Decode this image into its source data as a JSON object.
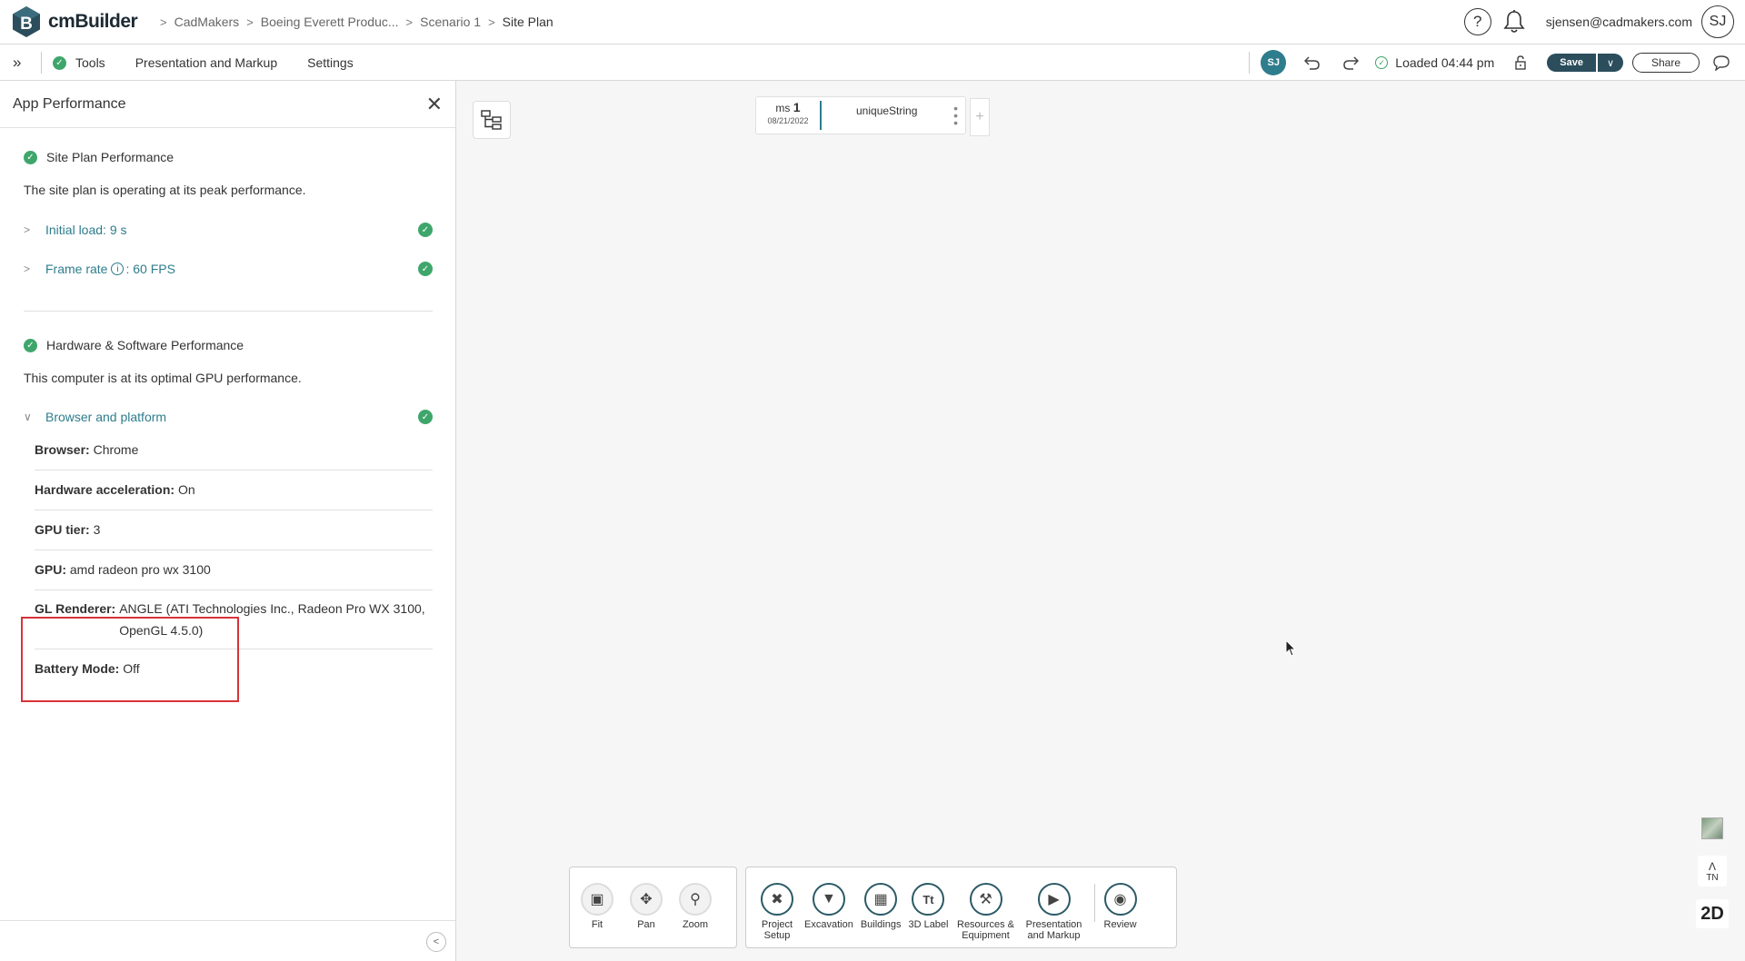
{
  "app": {
    "name": "cmBuilder"
  },
  "breadcrumb": [
    "CadMakers",
    "Boeing Everett Produc...",
    "Scenario 1",
    "Site Plan"
  ],
  "header": {
    "help_icon": "?",
    "user_email": "sjensen@cadmakers.com",
    "avatar_initials": "SJ"
  },
  "toolbar": {
    "menu": [
      "Tools",
      "Presentation and Markup",
      "Settings"
    ],
    "user_badge": "SJ",
    "loaded_status": "Loaded 04:44 pm",
    "save_label": "Save",
    "share_label": "Share"
  },
  "panel": {
    "title": "App Performance",
    "site": {
      "title": "Site Plan Performance",
      "description": "The site plan is operating at its peak performance.",
      "initial_load": "Initial load: 9 s",
      "frame_rate_label": "Frame rate",
      "frame_rate_value": ": 60 FPS"
    },
    "hardware": {
      "title": "Hardware & Software Performance",
      "description": "This computer is at its optimal GPU performance.",
      "browser_platform": "Browser and platform",
      "details": [
        {
          "key": "Browser:",
          "value": "Chrome"
        },
        {
          "key": "Hardware acceleration:",
          "value": "On"
        },
        {
          "key": "GPU tier:",
          "value": "3"
        },
        {
          "key": "GPU:",
          "value": "amd radeon pro wx 3100"
        },
        {
          "key": "GL Renderer:",
          "value": "ANGLE (ATI Technologies Inc., Radeon Pro WX 3100, OpenGL 4.5.0)"
        },
        {
          "key": "Battery Mode:",
          "value": "Off"
        }
      ]
    }
  },
  "milestone": {
    "prefix": "ms",
    "number": "1",
    "date": "08/21/2022",
    "name": "uniqueString",
    "add": "+"
  },
  "view_tools": [
    {
      "label": "Fit",
      "icon": "fit-icon"
    },
    {
      "label": "Pan",
      "icon": "pan-icon"
    },
    {
      "label": "Zoom",
      "icon": "zoom-icon"
    }
  ],
  "main_tools": [
    {
      "label": "Project Setup",
      "icon": "wrench-icon"
    },
    {
      "label": "Excavation",
      "icon": "shovel-icon"
    },
    {
      "label": "Buildings",
      "icon": "building-icon"
    },
    {
      "label": "3D Label",
      "icon": "text-label-icon"
    },
    {
      "label": "Resources & Equipment",
      "icon": "crane-icon"
    },
    {
      "label": "Presentation and Markup",
      "icon": "presentation-icon"
    },
    {
      "label": "Review",
      "icon": "review-icon"
    }
  ],
  "view_controls": {
    "north": "TN",
    "mode": "2D"
  },
  "colors": {
    "accent": "#2e7d8c",
    "success": "#3fa66b",
    "highlight": "#d9323a",
    "dark": "#2b4d5c"
  }
}
